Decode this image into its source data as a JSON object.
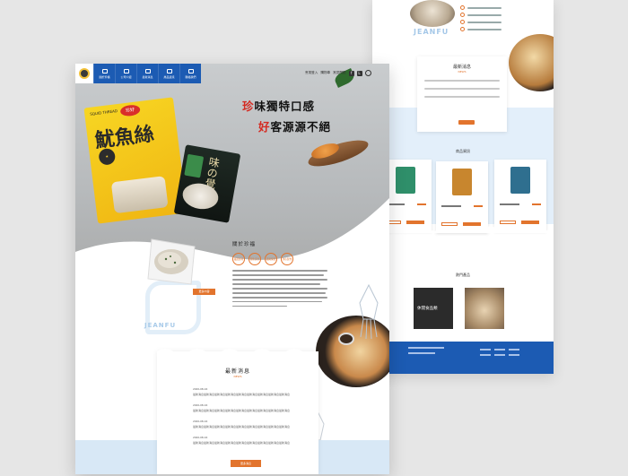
{
  "colors": {
    "brand_blue": "#1c5bb3",
    "accent_orange": "#e2742d",
    "highlight_red": "#d42a21",
    "light_blue": "#d8e8f6"
  },
  "back_page": {
    "brand_text": "JEANFU",
    "news_title": "最新消息",
    "news_subtitle": "NEWS",
    "products_title": "商品資訊",
    "hot_title": "熱門產品",
    "hot_caption": "休閒食品類"
  },
  "front_page": {
    "nav": {
      "logo": "logo-icon",
      "items": [
        {
          "label": "關於珍福",
          "icon": "flag-icon"
        },
        {
          "label": "公司介紹",
          "icon": "building-icon"
        },
        {
          "label": "最新消息",
          "icon": "news-icon"
        },
        {
          "label": "產品資訊",
          "icon": "box-icon"
        },
        {
          "label": "聯絡我們",
          "icon": "mail-icon"
        }
      ]
    },
    "utility": {
      "member": "會員登入",
      "cart": "購物車",
      "faq": "常見問題"
    },
    "slogan": {
      "line1_hi": "珍",
      "line1_rest": "味獨特口感",
      "line2_hi": "好",
      "line2_rest": "客源源不絕"
    },
    "packages": {
      "yellow_chars": "魷魚絲",
      "yellow_en": "SQUID THREAD",
      "brand": "珍好",
      "dark_chars": "味の覺"
    },
    "about": {
      "title": "關於珍福",
      "badges": [
        "嚴選食材",
        "衛生安全",
        "品質保證",
        "用心製作"
      ],
      "button": "更多內容",
      "brand_text": "JEANFU"
    },
    "news": {
      "title": "最新消息",
      "subtitle": "NEWS",
      "items": [
        {
          "date": "2020-08-16",
          "text": "最新消息最新消息最新消息最新消息最新消息最新消息最新消息最新消息最新消息"
        },
        {
          "date": "2020-08-16",
          "text": "最新消息最新消息最新消息最新消息最新消息最新消息最新消息最新消息最新消息"
        },
        {
          "date": "2020-08-16",
          "text": "最新消息最新消息最新消息最新消息最新消息最新消息最新消息最新消息最新消息"
        },
        {
          "date": "2020-08-16",
          "text": "最新消息最新消息最新消息最新消息最新消息最新消息最新消息最新消息最新消息"
        }
      ],
      "button": "更多消息"
    }
  }
}
